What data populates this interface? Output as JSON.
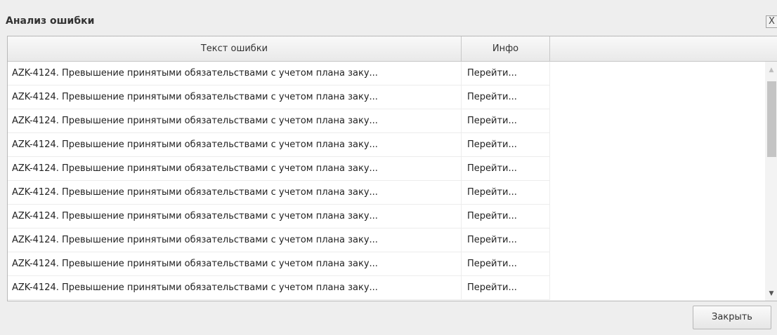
{
  "dialog": {
    "title": "Анализ ошибки",
    "close_glyph": "X",
    "close_button_label": "Закрыть"
  },
  "grid": {
    "columns": [
      "Текст ошибки",
      "Инфо"
    ],
    "rows": [
      {
        "text": "AZK-4124. Превышение принятыми обязательствами с учетом плана заку...",
        "info": "Перейти..."
      },
      {
        "text": "AZK-4124. Превышение принятыми обязательствами с учетом плана заку...",
        "info": "Перейти..."
      },
      {
        "text": "AZK-4124. Превышение принятыми обязательствами с учетом плана заку...",
        "info": "Перейти..."
      },
      {
        "text": "AZK-4124. Превышение принятыми обязательствами с учетом плана заку...",
        "info": "Перейти..."
      },
      {
        "text": "AZK-4124. Превышение принятыми обязательствами с учетом плана заку...",
        "info": "Перейти..."
      },
      {
        "text": "AZK-4124. Превышение принятыми обязательствами с учетом плана заку...",
        "info": "Перейти..."
      },
      {
        "text": "AZK-4124. Превышение принятыми обязательствами с учетом плана заку...",
        "info": "Перейти..."
      },
      {
        "text": "AZK-4124. Превышение принятыми обязательствами с учетом плана заку...",
        "info": "Перейти..."
      },
      {
        "text": "AZK-4124. Превышение принятыми обязательствами с учетом плана заку...",
        "info": "Перейти..."
      },
      {
        "text": "AZK-4124. Превышение принятыми обязательствами с учетом плана заку...",
        "info": "Перейти..."
      }
    ]
  },
  "icons": {
    "scroll_up": "scroll-up-arrow-icon",
    "scroll_down": "scroll-down-arrow-icon"
  }
}
